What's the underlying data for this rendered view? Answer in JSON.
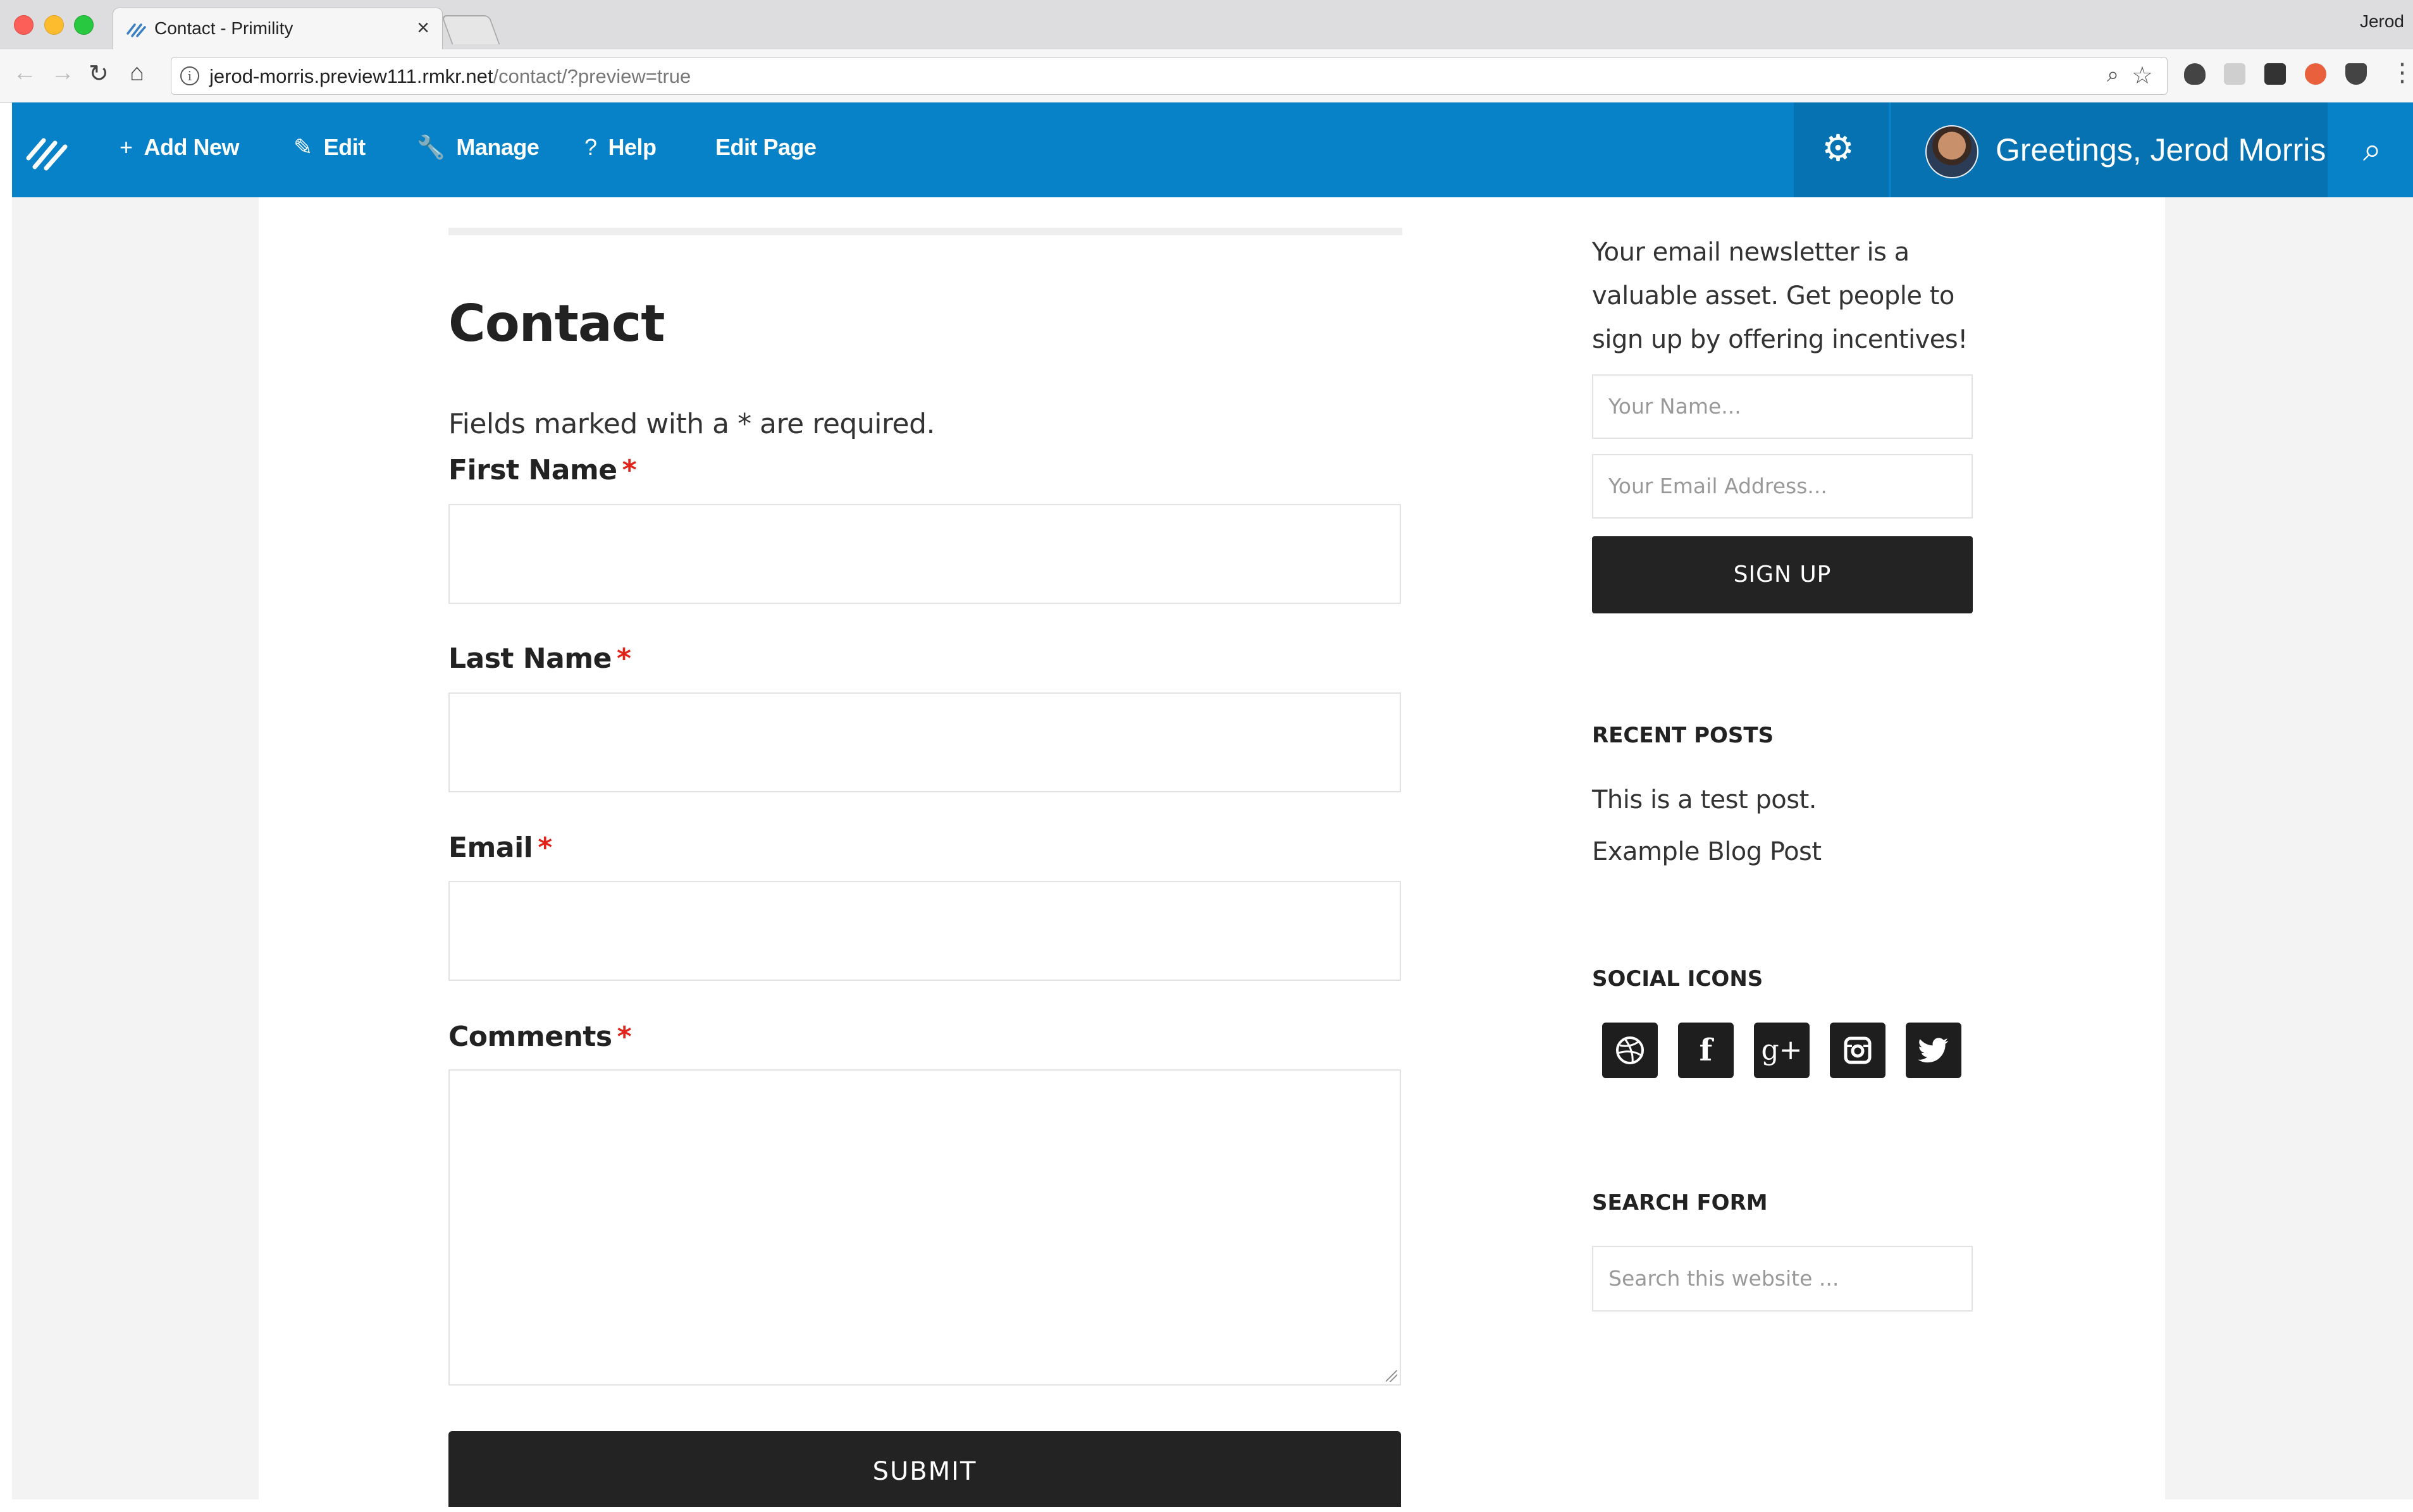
{
  "browser": {
    "tab_title": "Contact - Primility",
    "tab_close": "×",
    "profile_name": "Jerod",
    "url_host": "jerod-morris.preview111.rmkr.net",
    "url_path": "/contact/?preview=true",
    "nav": {
      "back": "←",
      "forward": "→",
      "reload": "↻",
      "home": "⌂",
      "menu": "⋮"
    }
  },
  "admin_bar": {
    "items": [
      {
        "icon": "+",
        "label": "Add New"
      },
      {
        "icon": "✎",
        "label": "Edit"
      },
      {
        "icon": "🔧",
        "label": "Manage"
      },
      {
        "icon": "?",
        "label": "Help"
      },
      {
        "label": "Edit Page"
      }
    ],
    "greeting": "Greetings, Jerod Morris",
    "accent": "#0782c8"
  },
  "main": {
    "title": "Contact",
    "required_note": "Fields marked with a * are required.",
    "fields": [
      {
        "label": "First Name",
        "required_mark": "*",
        "value": ""
      },
      {
        "label": "Last Name",
        "required_mark": "*",
        "value": ""
      },
      {
        "label": "Email",
        "required_mark": "*",
        "value": ""
      },
      {
        "label": "Comments",
        "required_mark": "*",
        "value": ""
      }
    ],
    "submit_label": "SUBMIT"
  },
  "sidebar": {
    "newsletter_text": "Your email newsletter is a valuable asset. Get people to sign up by offering incentives!",
    "name_placeholder": "Your Name...",
    "email_placeholder": "Your Email Address...",
    "signup_label": "SIGN UP",
    "recent_posts_title": "RECENT POSTS",
    "recent_posts": [
      "This is a test post.",
      "Example Blog Post"
    ],
    "social_title": "SOCIAL ICONS",
    "social_icons": [
      "dribbble-icon",
      "facebook-icon",
      "google-plus-icon",
      "instagram-icon",
      "twitter-icon"
    ],
    "search_title": "SEARCH FORM",
    "search_placeholder": "Search this website ..."
  }
}
